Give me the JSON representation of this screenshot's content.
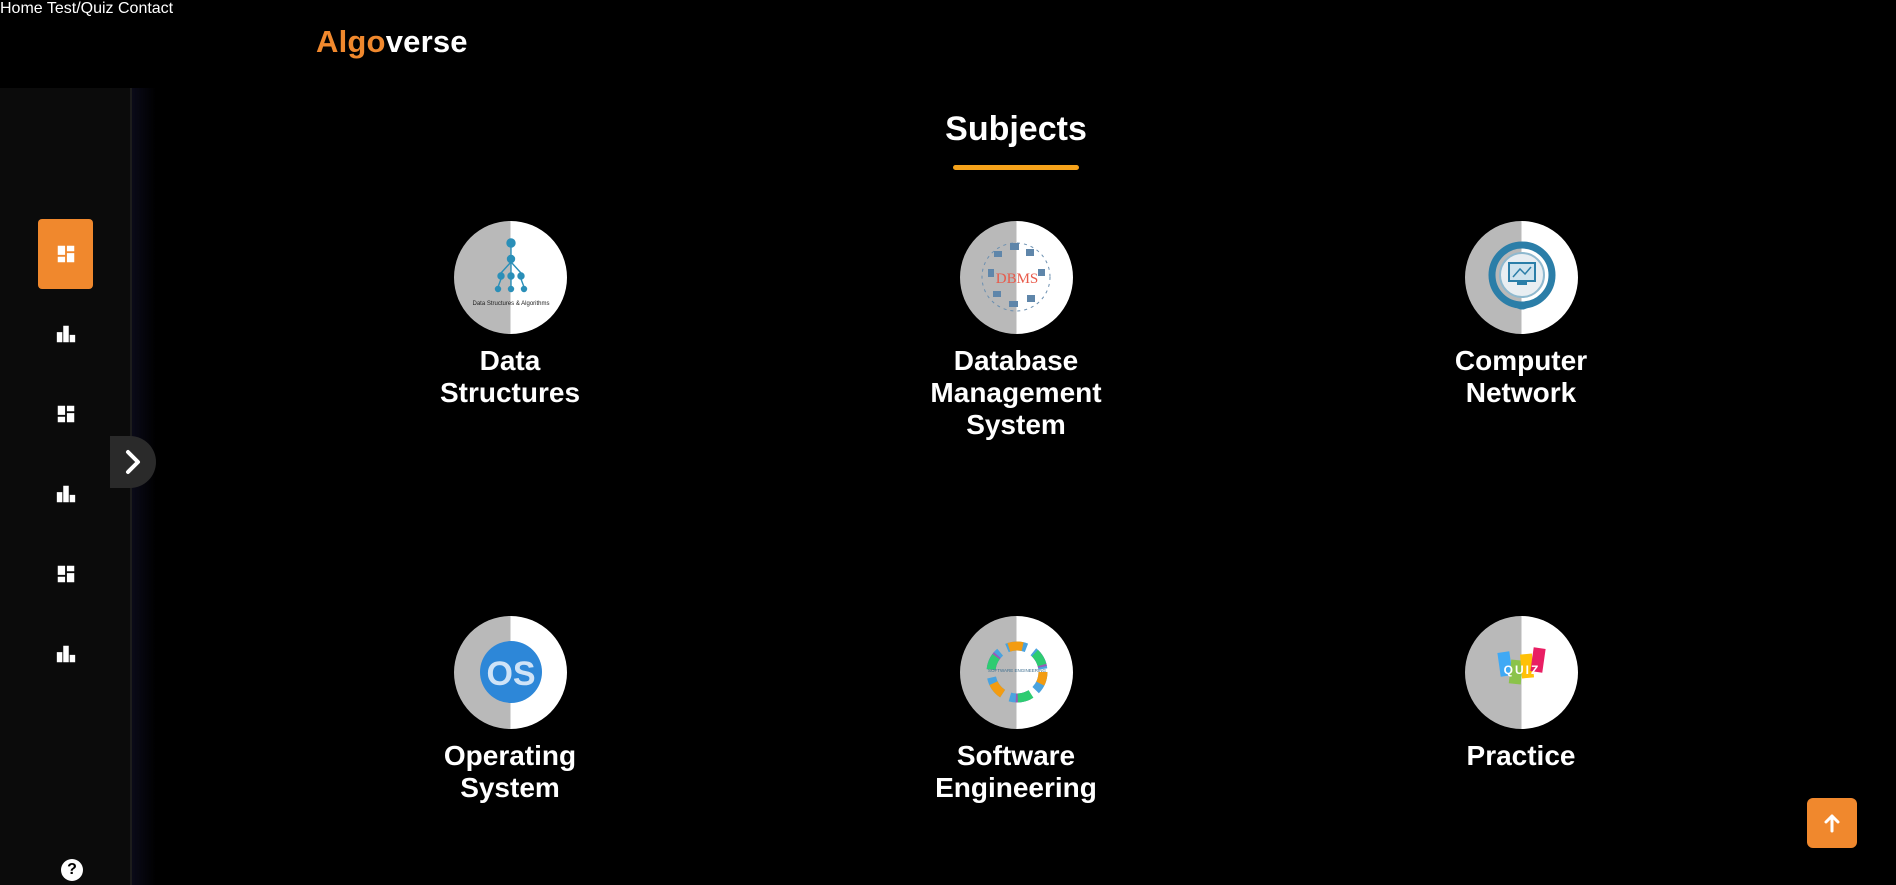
{
  "brand": {
    "part1": "Algo",
    "part2": "verse"
  },
  "nav": [
    {
      "label": "Home"
    },
    {
      "label": "Test/Quiz"
    },
    {
      "label": "Contact"
    }
  ],
  "sidebar": {
    "items": [
      {
        "icon": "dashboard-icon",
        "active": true
      },
      {
        "icon": "bar-chart-icon",
        "active": false
      },
      {
        "icon": "dashboard-icon",
        "active": false
      },
      {
        "icon": "bar-chart-icon",
        "active": false
      },
      {
        "icon": "dashboard-icon",
        "active": false
      },
      {
        "icon": "bar-chart-icon",
        "active": false
      }
    ],
    "help_icon": "question-icon",
    "help_glyph": "?",
    "toggle_icon": "chevron-right-icon"
  },
  "page": {
    "title": "Subjects"
  },
  "subjects": [
    {
      "label": "Data\nStructures",
      "icon": "data-structures-icon",
      "logo_text": "Data Structures & Algorithms"
    },
    {
      "label": "Database\nManagement\nSystem",
      "icon": "dbms-icon",
      "logo_text": "DBMS"
    },
    {
      "label": "Computer\nNetwork",
      "icon": "computer-network-icon"
    },
    {
      "label": "Operating\nSystem",
      "icon": "operating-system-icon",
      "logo_text": "OS"
    },
    {
      "label": "Software\nEngineering",
      "icon": "software-engineering-icon",
      "logo_text": "SOFTWARE ENGINEERING"
    },
    {
      "label": "Practice",
      "icon": "quiz-icon",
      "logo_text": "QUIZ"
    }
  ],
  "scroll_top_icon": "arrow-up-icon",
  "colors": {
    "accent": "#f0882d",
    "underline": "#f5a21a",
    "background": "#000000"
  }
}
